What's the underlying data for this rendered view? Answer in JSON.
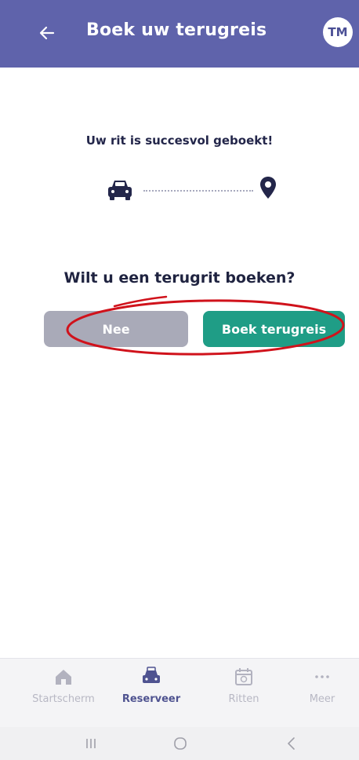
{
  "header": {
    "title": "Boek uw terugreis",
    "avatar_initials": "TM"
  },
  "confirmation": {
    "message": "Uw rit is succesvol geboekt!"
  },
  "prompt": {
    "question": "Wilt u een terugrit boeken?",
    "no_label": "Nee",
    "yes_label": "Boek terugreis"
  },
  "nav": {
    "items": [
      {
        "label": "Startscherm",
        "icon": "home-icon"
      },
      {
        "label": "Reserveer",
        "icon": "car-booking-icon"
      },
      {
        "label": "Ritten",
        "icon": "calendar-icon"
      },
      {
        "label": "Meer",
        "icon": "more-icon"
      }
    ]
  },
  "colors": {
    "header": "#5f63ab",
    "primary_button": "#1f9d86",
    "secondary_button": "#a9aab8",
    "annotation": "#d0121b"
  }
}
